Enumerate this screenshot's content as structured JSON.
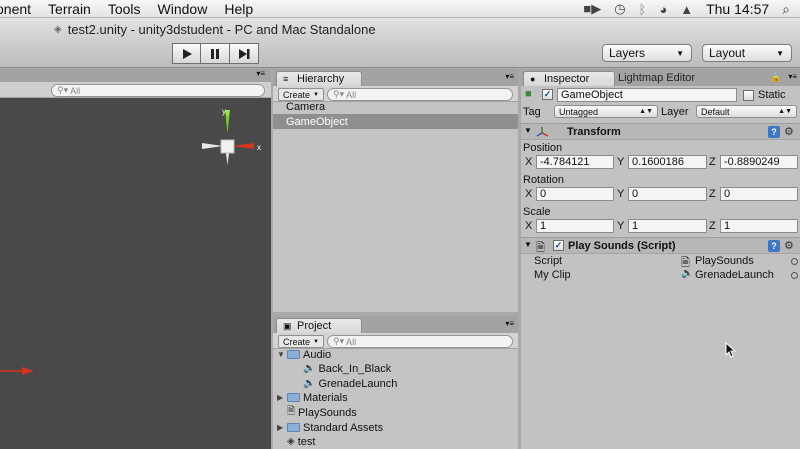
{
  "menubar": {
    "items": [
      "onent",
      "Terrain",
      "Tools",
      "Window",
      "Help"
    ],
    "clock": "Thu 14:57"
  },
  "window": {
    "title": "test2.unity - unity3dstudent - PC and Mac Standalone"
  },
  "toolbar": {
    "layers_label": "Layers",
    "layout_label": "Layout"
  },
  "scene": {
    "search_placeholder": "All",
    "gizmo_y": "y",
    "gizmo_x": "x"
  },
  "hierarchy": {
    "tab": "Hierarchy",
    "create_label": "Create",
    "search_placeholder": "All",
    "items": [
      {
        "label": "Camera",
        "selected": false
      },
      {
        "label": "GameObject",
        "selected": true
      }
    ]
  },
  "project": {
    "tab": "Project",
    "create_label": "Create",
    "search_placeholder": "All",
    "items": [
      {
        "label": "Audio",
        "type": "folder",
        "expanded": true
      },
      {
        "label": "Back_In_Black",
        "type": "audio"
      },
      {
        "label": "GrenadeLaunch",
        "type": "audio"
      },
      {
        "label": "Materials",
        "type": "folder",
        "expanded": false
      },
      {
        "label": "PlaySounds",
        "type": "script"
      },
      {
        "label": "Standard Assets",
        "type": "folder",
        "expanded": false
      },
      {
        "label": "test",
        "type": "scene"
      }
    ]
  },
  "inspector": {
    "tab": "Inspector",
    "tab2": "Lightmap Editor",
    "object_name": "GameObject",
    "static_label": "Static",
    "tag_label": "Tag",
    "tag_value": "Untagged",
    "layer_label": "Layer",
    "layer_value": "Default",
    "transform": {
      "title": "Transform",
      "position_label": "Position",
      "rotation_label": "Rotation",
      "scale_label": "Scale",
      "axis_x": "X",
      "axis_y": "Y",
      "axis_z": "Z",
      "position": [
        "-4.784121",
        "0.1600186",
        "-0.8890249"
      ],
      "rotation": [
        "0",
        "0",
        "0"
      ],
      "scale": [
        "1",
        "1",
        "1"
      ]
    },
    "script_component": {
      "title": "Play Sounds (Script)",
      "script_label": "Script",
      "script_value": "PlaySounds",
      "clip_label": "My Clip",
      "clip_value": "GrenadeLaunch"
    }
  },
  "colors": {
    "gizmo_x": "#d8331b",
    "gizmo_y": "#6fd31f",
    "selection": "#8f8f8f"
  }
}
